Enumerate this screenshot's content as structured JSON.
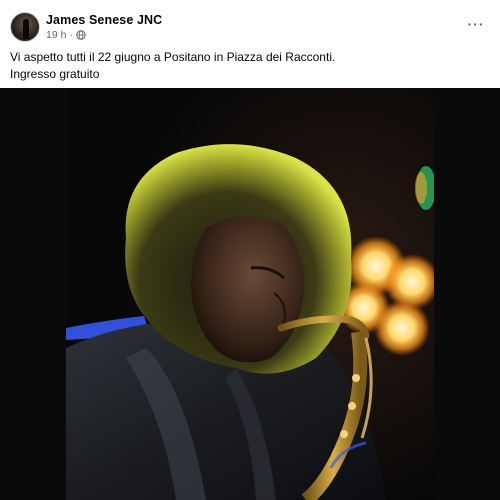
{
  "post": {
    "author": "James Senese JNC",
    "time": "19 h",
    "separator": "·",
    "privacy_icon": "globe-icon",
    "more_icon": "more-options-icon",
    "more_label": "···",
    "caption_lines": [
      "Vi aspetto tutti il 22 giugno a Positano in Piazza dei Racconti.",
      "Ingresso gratuito"
    ],
    "image_icon": "photo-saxophonist"
  },
  "colors": {
    "page_bg": "#ffffff",
    "text_primary": "#050505",
    "text_secondary": "#65676b",
    "media_bg": "#0a0a0a"
  }
}
